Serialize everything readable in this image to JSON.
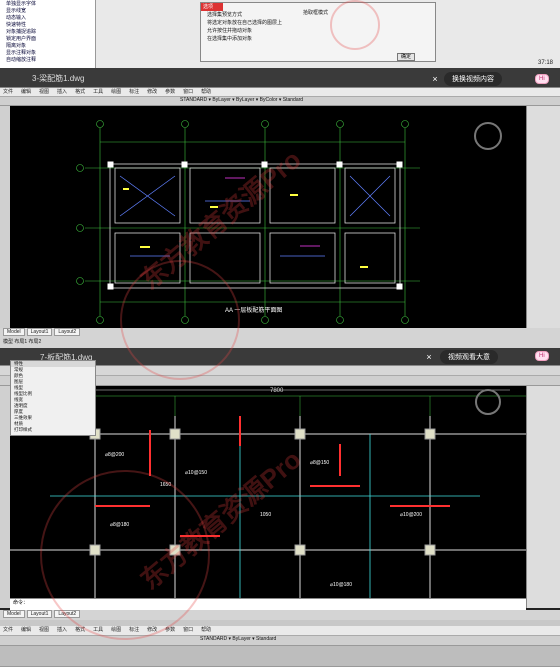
{
  "top_dialog": {
    "tree_items": [
      "单独显示字体",
      "显示线宽",
      "动态输入",
      "快速特性",
      "对象捕捉追踪",
      "锁定用户界面",
      "隔离对象",
      "显示注释对象",
      "自动缩放注释",
      "注释比例"
    ],
    "title": "选项",
    "rows": [
      "选择集预览方式",
      "拾取框大小",
      "将选定对象放在自己选择的图层上",
      "允许按住并拖动对象",
      "在选择集中添加对象"
    ],
    "radio_label": "拾取框模式",
    "ok_label": "确定",
    "timecode": "37:18"
  },
  "frame1": {
    "title": "3-梁配筋1.dwg",
    "menus": [
      "文件",
      "编辑",
      "视图",
      "插入",
      "格式",
      "工具",
      "绘图",
      "标注",
      "修改",
      "参数",
      "窗口",
      "帮助"
    ],
    "toolbar_text": "STANDARD  ▾  ByLayer  ▾  ByLayer  ▾  ByColor  ▾  Standard",
    "drawing_caption": "AA 一层板配筋平面图",
    "status_text": "模型  布局1  布局2",
    "tabs": [
      "Model",
      "Layout1",
      "Layout2"
    ],
    "pill": "换换视频内容",
    "hi": "Hi",
    "close": "×"
  },
  "frame2": {
    "title": "7-板配筋1.dwg",
    "pill": "视频观看大意",
    "hi": "Hi",
    "close": "×",
    "dimension": "7800",
    "prop_title": "特性",
    "prop_rows": [
      "常规",
      "颜色",
      "图层",
      "线型",
      "线型比例",
      "线宽",
      "透明度",
      "厚度",
      "三维效果",
      "材质",
      "打印样式",
      "视图"
    ],
    "tags": [
      "⌀8@200",
      "⌀10@150",
      "⌀8@150",
      "⌀10@200",
      "⌀8@180",
      "1650",
      "1050",
      "⌀10@180"
    ],
    "cmd": "命令：",
    "tabs": [
      "Model",
      "Layout1",
      "Layout2"
    ]
  },
  "frame3": {
    "menus": [
      "文件",
      "编辑",
      "视图",
      "插入",
      "格式",
      "工具",
      "绘图",
      "标注",
      "修改",
      "参数",
      "窗口",
      "帮助"
    ],
    "toolbar_text": "STANDARD  ▾  ByLayer  ▾  Standard"
  },
  "watermark_text": "东方教育资源Pro",
  "colors": {
    "grid_green": "#3fbf3f",
    "rebar_white": "#dcdcdc",
    "col_yellow": "#ffff40",
    "beam_red": "#ff3030",
    "cyan": "#40e0e0",
    "magenta": "#ff40ff"
  }
}
